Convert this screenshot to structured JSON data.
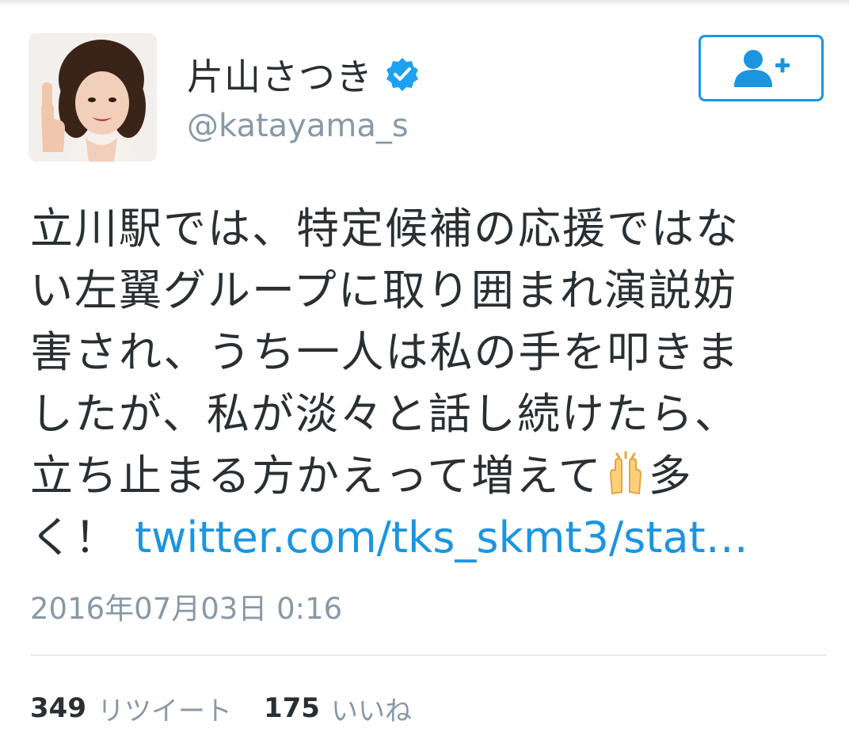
{
  "tweet": {
    "author": {
      "display_name": "片山さつき",
      "handle": "@katayama_s",
      "verified": true
    },
    "follow_button": {
      "icon": "add-user-icon"
    },
    "text_lines": [
      "立川駅では、特定候補の応援ではな",
      "い左翼グループに取り囲まれ演説妨",
      "害され、うち一人は私の手を叩きま",
      "したが、私が淡々と話し続けたら、",
      "立ち止まる方かえって増えて",
      "多",
      "く！"
    ],
    "inline_emoji": "clapping-hands-icon",
    "link_text": "twitter.com/tks_skmt3/stat…",
    "timestamp": "2016年07月03日 0:16",
    "stats": {
      "retweets_count": "349",
      "retweets_label": "リツイート",
      "likes_count": "175",
      "likes_label": "いいね"
    }
  },
  "colors": {
    "text": "#292f33",
    "muted": "#8899a6",
    "accent": "#1b95e0",
    "divider": "#e6ecf0"
  }
}
